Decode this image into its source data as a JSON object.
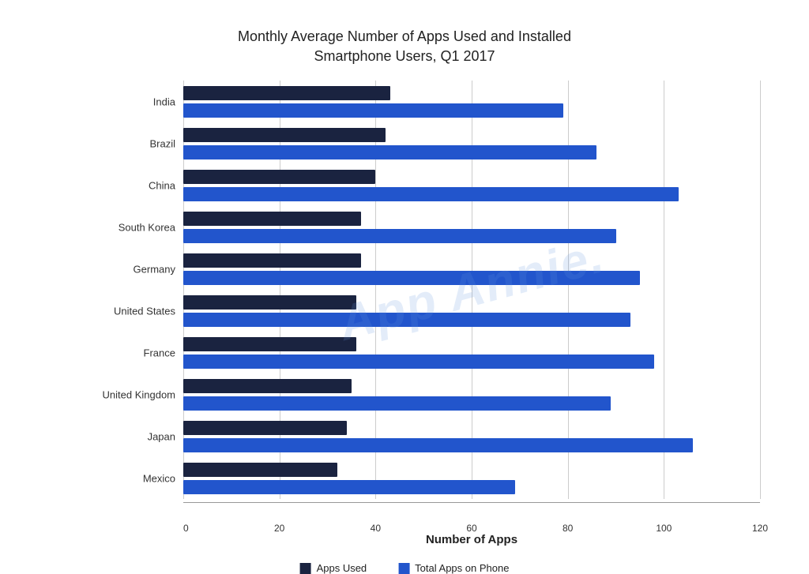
{
  "title": {
    "line1": "Monthly Average Number of Apps Used and Installed",
    "line2": "Smartphone Users, Q1 2017"
  },
  "xAxis": {
    "label": "Number of Apps",
    "ticks": [
      "0",
      "20",
      "40",
      "60",
      "80",
      "100",
      "120"
    ]
  },
  "legend": {
    "items": [
      {
        "label": "Apps Used",
        "color": "#1a2340"
      },
      {
        "label": "Total Apps on Phone",
        "color": "#2255cc"
      }
    ]
  },
  "watermark": "App Annie.",
  "maxValue": 120,
  "countries": [
    {
      "name": "India",
      "used": 43,
      "total": 79
    },
    {
      "name": "Brazil",
      "used": 42,
      "total": 86
    },
    {
      "name": "China",
      "used": 40,
      "total": 103
    },
    {
      "name": "South Korea",
      "used": 37,
      "total": 90
    },
    {
      "name": "Germany",
      "used": 37,
      "total": 95
    },
    {
      "name": "United States",
      "used": 36,
      "total": 93
    },
    {
      "name": "France",
      "used": 36,
      "total": 98
    },
    {
      "name": "United Kingdom",
      "used": 35,
      "total": 89
    },
    {
      "name": "Japan",
      "used": 34,
      "total": 106
    },
    {
      "name": "Mexico",
      "used": 32,
      "total": 69
    }
  ]
}
